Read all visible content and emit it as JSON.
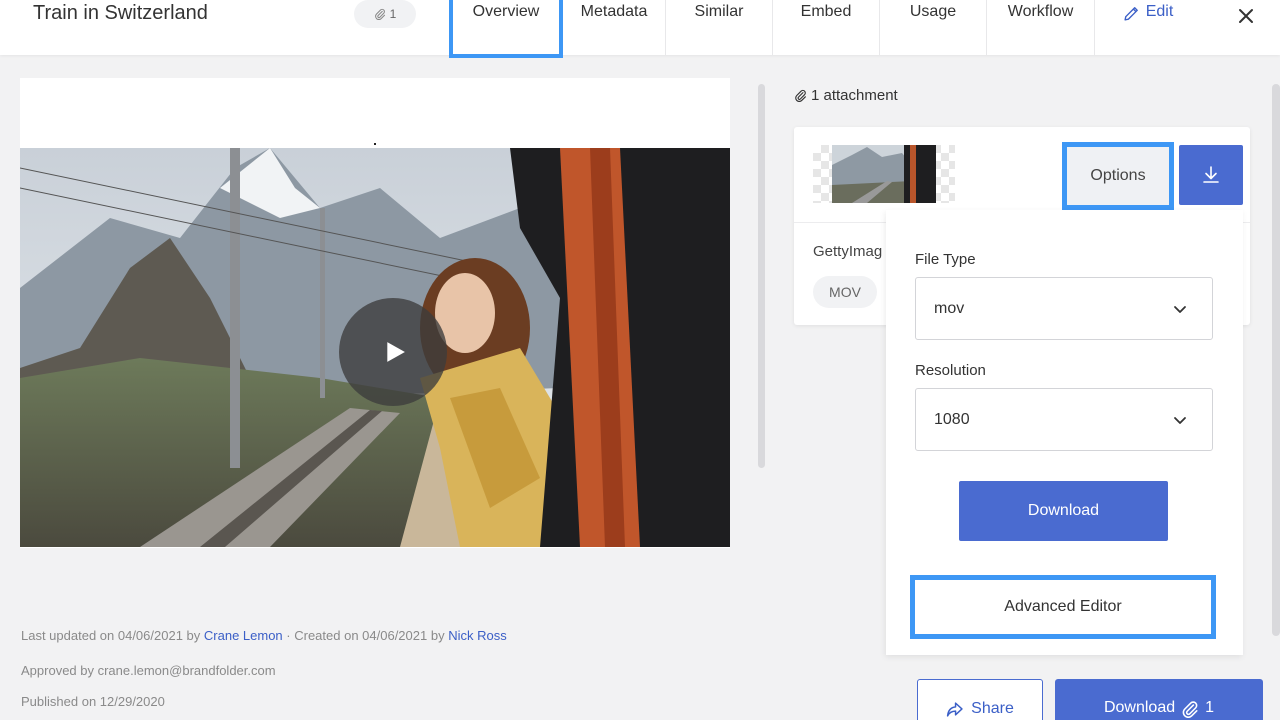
{
  "header": {
    "title": "Train in Switzerland",
    "attachment_count": "1",
    "tabs": [
      {
        "label": "Overview"
      },
      {
        "label": "Metadata"
      },
      {
        "label": "Similar"
      },
      {
        "label": "Embed"
      },
      {
        "label": "Usage"
      },
      {
        "label": "Workflow"
      },
      {
        "label": "Edit"
      }
    ],
    "icons": {
      "attachment": "paperclip-icon",
      "edit": "pencil-icon",
      "close": "close-icon"
    }
  },
  "media": {
    "play_icon": "play-icon"
  },
  "meta": {
    "updated_prefix": "Last updated on 04/06/2021 by ",
    "updated_by": "Crane Lemon",
    "created_prefix": " · Created on 04/06/2021 by ",
    "created_by": "Nick Ross",
    "approved": "Approved by crane.lemon@brandfolder.com",
    "published": "Published on 12/29/2020"
  },
  "attachments": {
    "heading": "1 attachment",
    "filename": "GettyImag",
    "file_tag": "MOV",
    "options_label": "Options",
    "download_icon": "download-icon"
  },
  "dropdown": {
    "file_type_label": "File Type",
    "file_type_value": "mov",
    "resolution_label": "Resolution",
    "resolution_value": "1080",
    "download_label": "Download",
    "advanced_editor_label": "Advanced Editor"
  },
  "footer": {
    "share_label": "Share",
    "download_all_label": "Download",
    "download_all_count": "1"
  },
  "colors": {
    "accent": "#4a6bd0",
    "highlight": "#3d97f5",
    "link": "#3b5fc7"
  }
}
